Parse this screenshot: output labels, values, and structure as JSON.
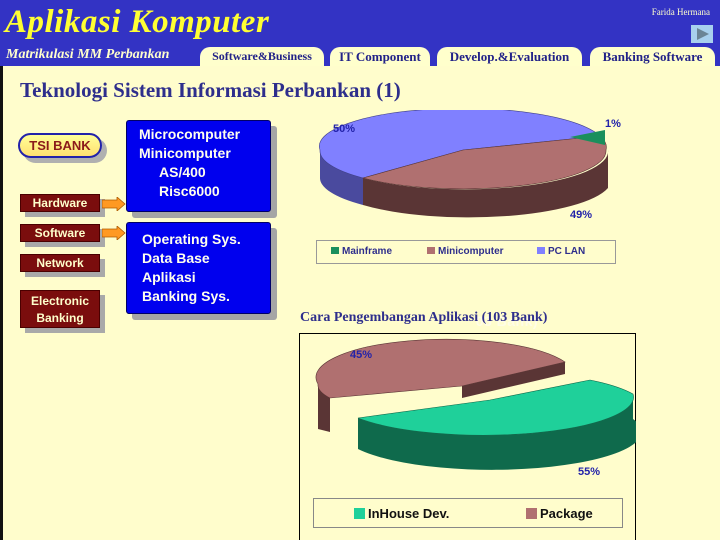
{
  "header": {
    "app_title": "Aplikasi Komputer",
    "subtitle": "Matrikulasi MM Perbankan",
    "author": "Farida Hermana",
    "next_button": "play-next-icon"
  },
  "nav": {
    "tabs": [
      {
        "label": "Software&Business"
      },
      {
        "label": "IT Component"
      },
      {
        "label": "Develop.&Evaluation"
      },
      {
        "label": "Banking Software"
      }
    ]
  },
  "page": {
    "title": "Teknologi Sistem Informasi Perbankan (1)"
  },
  "diagram": {
    "root_label": "TSI BANK",
    "categories": [
      {
        "label": "Hardware"
      },
      {
        "label": "Software"
      },
      {
        "label": "Network"
      },
      {
        "label_line1": "Electronic",
        "label_line2": "Banking"
      }
    ],
    "hardware_items": [
      "Microcomputer",
      "Minicomputer",
      "AS/400",
      "Risc6000"
    ],
    "software_items": [
      "Operating Sys.",
      "Data Base",
      "Aplikasi",
      "Banking Sys."
    ]
  },
  "colors": {
    "header_bg": "#3333c4",
    "body_bg": "#fffdcc",
    "title_yellow": "#ffff33",
    "box_blue": "#0000ee",
    "category_red": "#7a0d0d",
    "mainframe": "#1a8f5c",
    "minicomputer": "#b07070",
    "pc_lan": "#8080ff",
    "inhouse": "#1fd09a",
    "package": "#b07070"
  },
  "chart_data": [
    {
      "type": "pie",
      "title": "",
      "categories": [
        "Mainframe",
        "Minicomputer",
        "PC LAN"
      ],
      "values": [
        1,
        49,
        50
      ],
      "labels": [
        "1%",
        "49%",
        "50%"
      ],
      "legend": "bottom",
      "style": "3d"
    },
    {
      "type": "pie",
      "title": "Cara Pengembangan Aplikasi (103 Bank)",
      "title_ghost": "Cara Pengembangan Aplikasi (103 Bank)",
      "categories": [
        "InHouse Dev.",
        "Package"
      ],
      "values": [
        55,
        45
      ],
      "labels": [
        "55%",
        "45%"
      ],
      "legend": "bottom",
      "style": "3d-exploded"
    }
  ]
}
